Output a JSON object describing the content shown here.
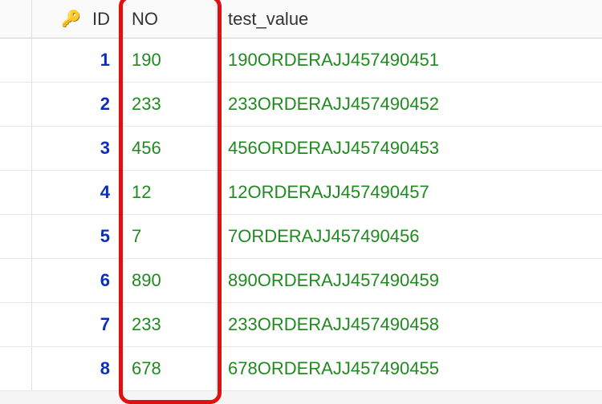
{
  "columns": {
    "id": "ID",
    "no": "NO",
    "test_value": "test_value"
  },
  "icons": {
    "primary_key": "🔑"
  },
  "rows": [
    {
      "id": "1",
      "no": "190",
      "test_value": "190ORDERAJJ457490451"
    },
    {
      "id": "2",
      "no": "233",
      "test_value": "233ORDERAJJ457490452"
    },
    {
      "id": "3",
      "no": "456",
      "test_value": "456ORDERAJJ457490453"
    },
    {
      "id": "4",
      "no": "12",
      "test_value": "12ORDERAJJ457490457"
    },
    {
      "id": "5",
      "no": "7",
      "test_value": "7ORDERAJJ457490456"
    },
    {
      "id": "6",
      "no": "890",
      "test_value": "890ORDERAJJ457490459"
    },
    {
      "id": "7",
      "no": "233",
      "test_value": "233ORDERAJJ457490458"
    },
    {
      "id": "8",
      "no": "678",
      "test_value": "678ORDERAJJ457490455"
    }
  ]
}
